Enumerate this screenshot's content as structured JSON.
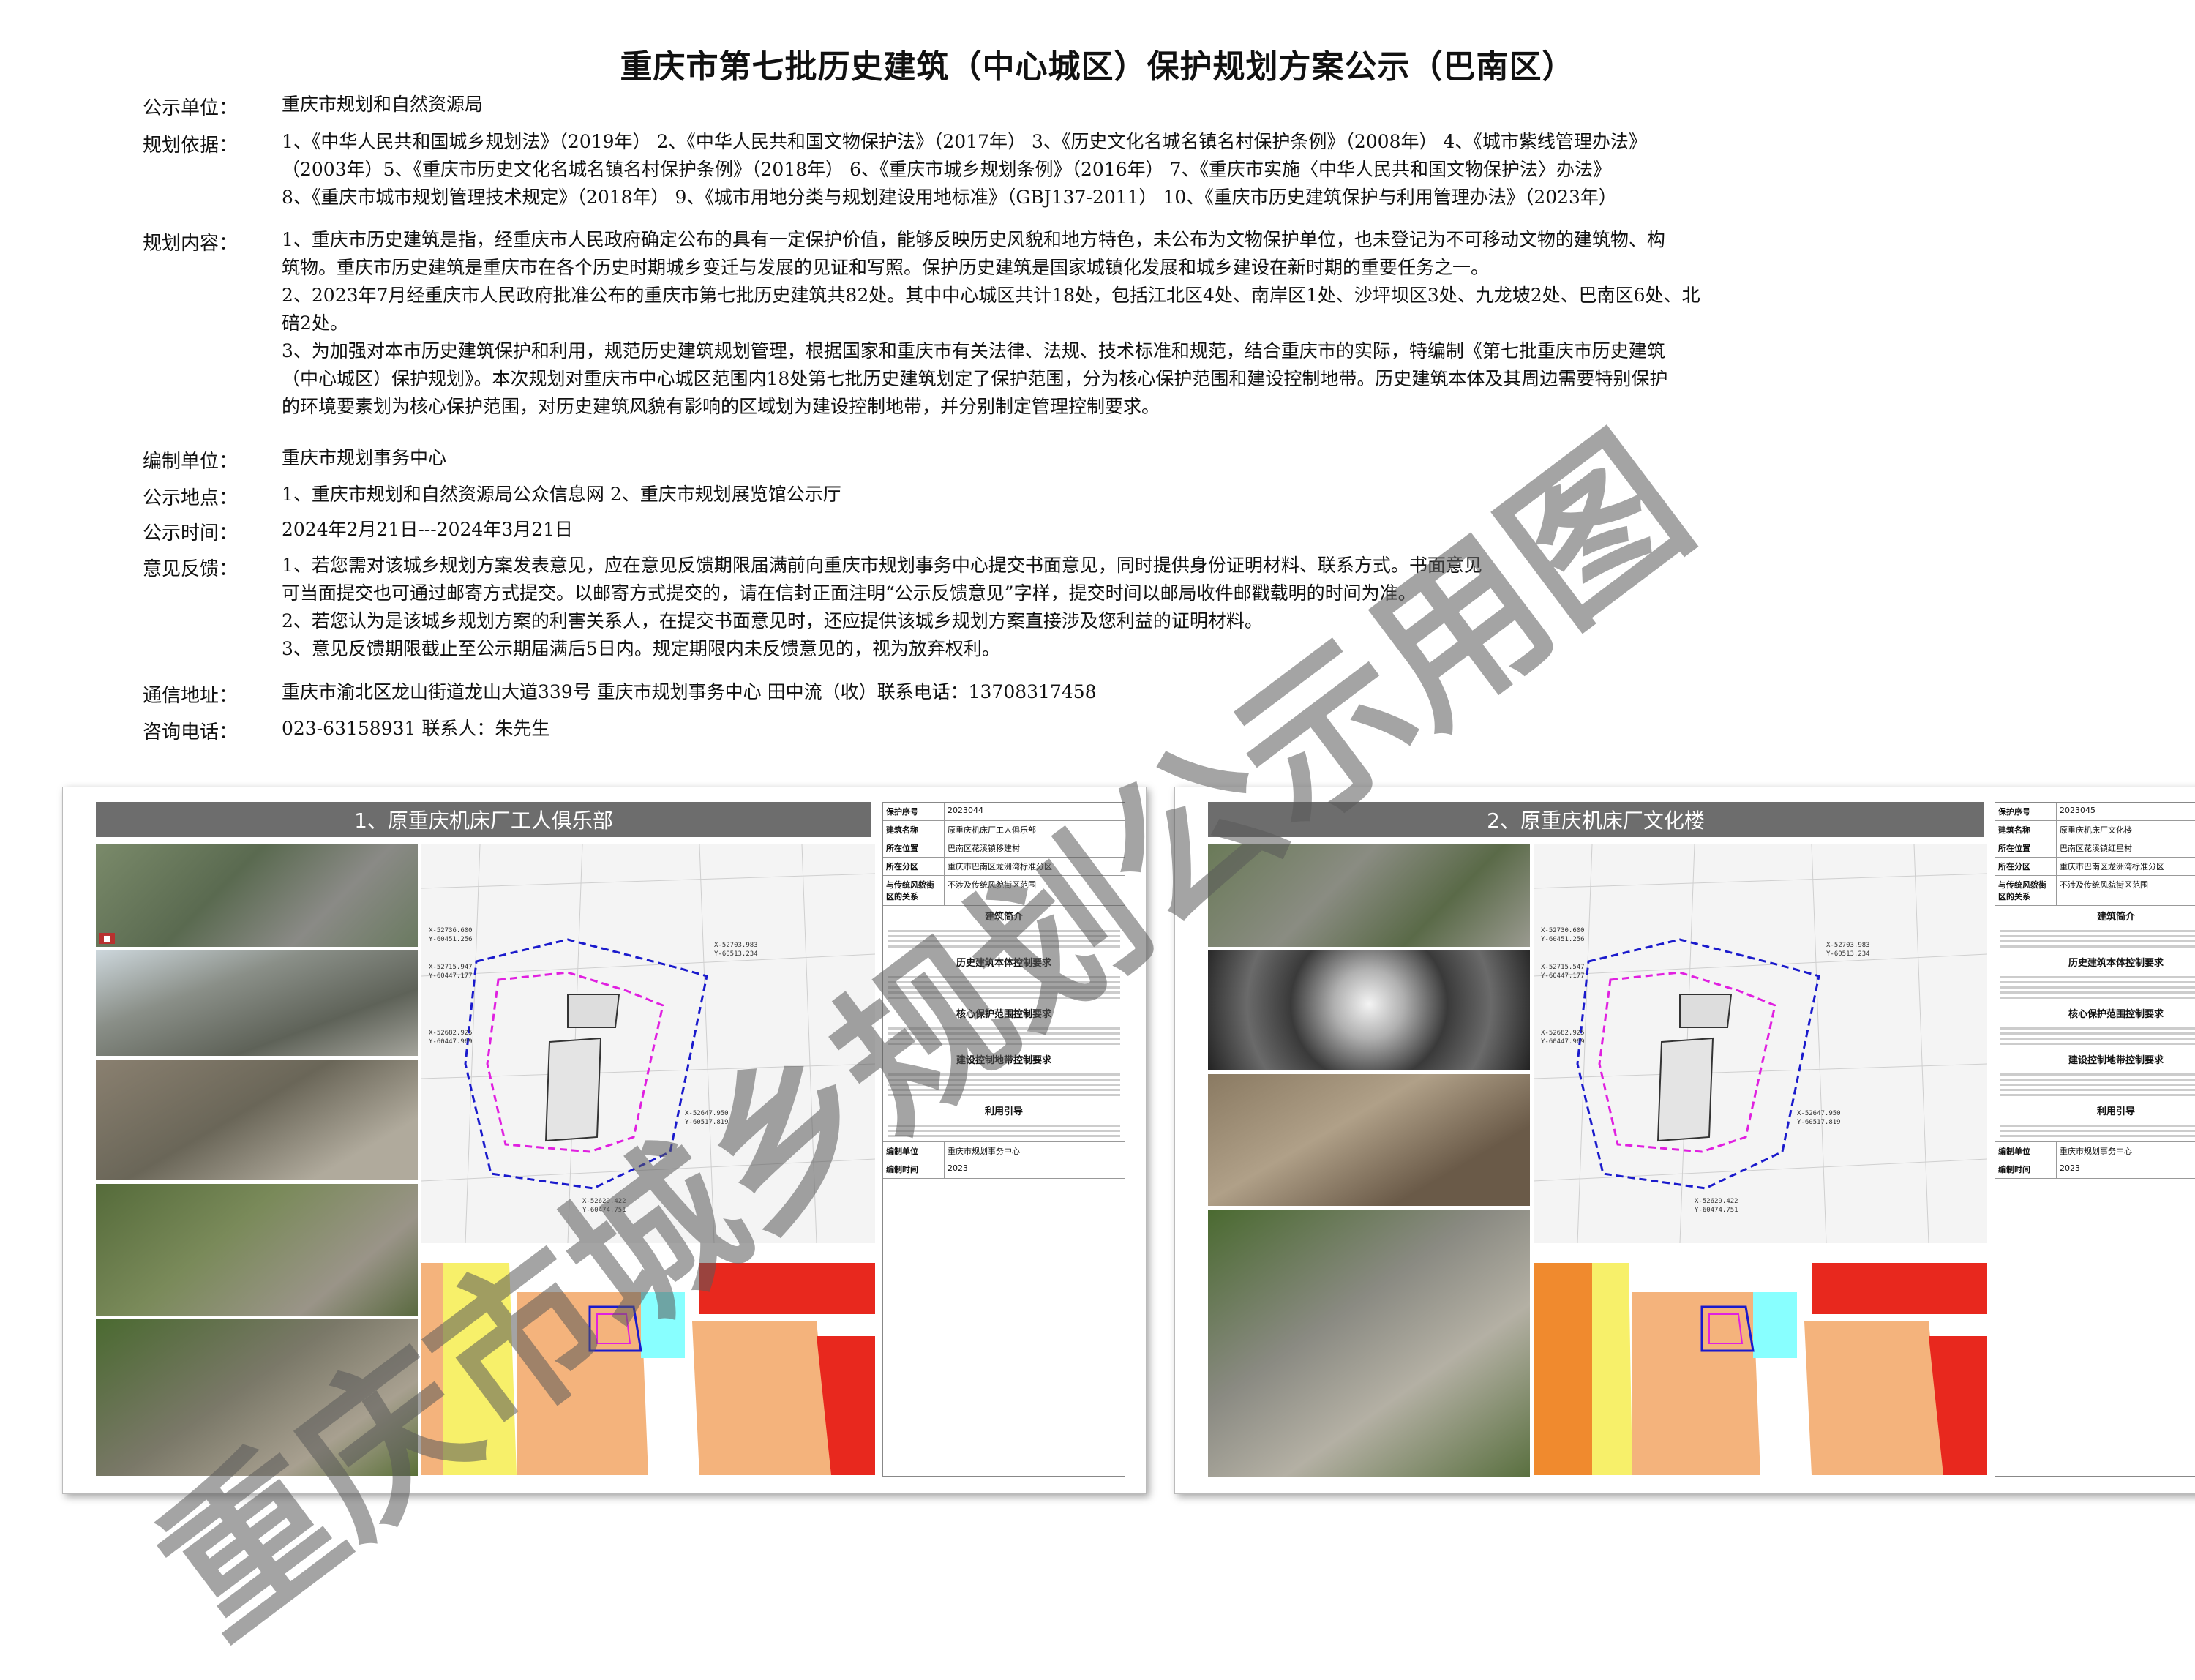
{
  "title": "重庆市第七批历史建筑（中心城区）保护规划方案公示（巴南区）",
  "fields": {
    "publisher_label": "公示单位：",
    "publisher": "重庆市规划和自然资源局",
    "basis_label": "规划依据：",
    "basis_lines": [
      "1、《中华人民共和国城乡规划法》（2019年）  2、《中华人民共和国文物保护法》（2017年）  3、《历史文化名城名镇名村保护条例》（2008年）  4、《城市紫线管理办法》",
      "（2003年）5、《重庆市历史文化名城名镇名村保护条例》（2018年）    6、《重庆市城乡规划条例》（2016年）    7、《重庆市实施〈中华人民共和国文物保护法〉办法》",
      "8、《重庆市城市规划管理技术规定》（2018年）    9、《城市用地分类与规划建设用地标准》（GBJ137-2011）   10、《重庆市历史建筑保护与利用管理办法》（2023年）"
    ],
    "content_label": "规划内容：",
    "content_lines": [
      "1、重庆市历史建筑是指，经重庆市人民政府确定公布的具有一定保护价值，能够反映历史风貌和地方特色，未公布为文物保护单位，也未登记为不可移动文物的建筑物、构",
      "筑物。重庆市历史建筑是重庆市在各个历史时期城乡变迁与发展的见证和写照。保护历史建筑是国家城镇化发展和城乡建设在新时期的重要任务之一。",
      "2、2023年7月经重庆市人民政府批准公布的重庆市第七批历史建筑共82处。其中中心城区共计18处，包括江北区4处、南岸区1处、沙坪坝区3处、九龙坡2处、巴南区6处、北",
      "碚2处。",
      "3、为加强对本市历史建筑保护和利用，规范历史建筑规划管理，根据国家和重庆市有关法律、法规、技术标准和规范，结合重庆市的实际，特编制《第七批重庆市历史建筑",
      "（中心城区）保护规划》。本次规划对重庆市中心城区范围内18处第七批历史建筑划定了保护范围，分为核心保护范围和建设控制地带。历史建筑本体及其周边需要特别保护",
      "的环境要素划为核心保护范围，对历史建筑风貌有影响的区域划为建设控制地带，并分别制定管理控制要求。"
    ],
    "compiler_label": "编制单位：",
    "compiler": "重庆市规划事务中心",
    "location_label": "公示地点：",
    "location": "1、重庆市规划和自然资源局公众信息网      2、重庆市规划展览馆公示厅",
    "time_label": "公示时间：",
    "time": "2024年2月21日---2024年3月21日",
    "feedback_label": "意见反馈：",
    "feedback_lines": [
      "1、若您需对该城乡规划方案发表意见，应在意见反馈期限届满前向重庆市规划事务中心提交书面意见，同时提供身份证明材料、联系方式。书面意见",
      "    可当面提交也可通过邮寄方式提交。以邮寄方式提交的，请在信封正面注明“公示反馈意见”字样，提交时间以邮局收件邮戳载明的时间为准。",
      "2、若您认为是该城乡规划方案的利害关系人，在提交书面意见时，还应提供该城乡规划方案直接涉及您利益的证明材料。",
      "3、意见反馈期限截止至公示期届满后5日内。规定期限内未反馈意见的，视为放弃权利。"
    ],
    "address_label": "通信地址：",
    "address": "重庆市渝北区龙山街道龙山大道339号 重庆市规划事务中心 田中流（收）联系电话：13708317458",
    "phone_label": "咨询电话：",
    "phone": "023-63158931        联系人：朱先生"
  },
  "watermark": "重庆市城乡规划公示用图",
  "boards": [
    {
      "heading": "1、原重庆机床厂工人俱乐部",
      "code": "2023044",
      "name": "原重庆机床厂工人俱乐部",
      "address": "巴南区花溪镇移建村",
      "zone": "重庆市巴南区龙洲湾标准分区",
      "area": "不涉及传统风貌街区范围",
      "unit": "重庆市规划事务中心",
      "year": "2023"
    },
    {
      "heading": "2、原重庆机床厂文化楼",
      "code": "2023045",
      "name": "原重庆机床厂文化楼",
      "address": "巴南区花溪镇红星村",
      "zone": "重庆市巴南区龙洲湾标准分区",
      "area": "不涉及传统风貌街区范围",
      "unit": "重庆市规划事务中心",
      "year": "2023"
    }
  ],
  "info_labels": {
    "code": "保护序号",
    "name": "建筑名称",
    "address": "所在位置",
    "zone": "所在分区",
    "area": "与传统风貌街区的关系",
    "intro": "建筑简介",
    "req1": "历史建筑本体控制要求",
    "req2": "核心保护范围控制要求",
    "req3": "建设控制地带控制要求",
    "guide": "利用引导",
    "unit_label": "编制单位",
    "date_label": "编制时间"
  },
  "colors": {
    "boundary_core": "#e020e0",
    "boundary_control": "#1a1acc",
    "residential": "#f4b37c",
    "commercial": "#e8281e",
    "green": "#f7f06a",
    "header_bg": "#6d6d6d"
  }
}
